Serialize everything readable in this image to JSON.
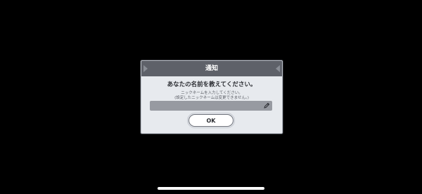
{
  "dialog": {
    "title": "通知",
    "message": "あなたの名前を教えてください。",
    "hint_line1": "ニックネームを入力してください。",
    "hint_line2": "(設定したニックネームは変更できません。)",
    "name_input_value": "",
    "ok_label": "OK"
  },
  "icons": {
    "edit": "pencil-icon",
    "header_left": "header-ornament-icon",
    "header_right": "header-ornament-icon"
  },
  "colors": {
    "background": "#000000",
    "dialog_body": "#e7eaee",
    "dialog_header": "#5e6169",
    "input_field": "#979aa1"
  }
}
